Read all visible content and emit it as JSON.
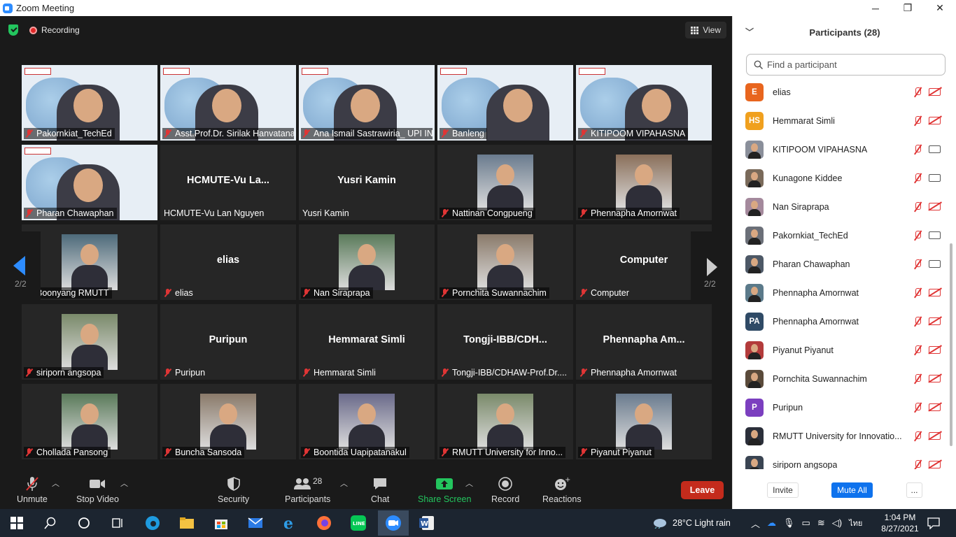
{
  "window": {
    "title": "Zoom Meeting"
  },
  "topbar": {
    "recording": "Recording",
    "view": "View"
  },
  "gallery": {
    "page_left": "2/2",
    "page_right": "2/2",
    "tiles": [
      {
        "name": "Pakornkiat_TechEd",
        "kind": "conf"
      },
      {
        "name": "Asst.Prof.Dr. Sirilak Hanvatananukul",
        "kind": "conf"
      },
      {
        "name": "Ana Ismail Sastrawiria_ UPI IN...",
        "kind": "conf"
      },
      {
        "name": "Banleng",
        "kind": "conf"
      },
      {
        "name": "KITIPOOM VIPAHASNA",
        "kind": "conf"
      },
      {
        "name": "Pharan Chawaphan",
        "kind": "conf"
      },
      {
        "name": "HCMUTE-Vu Lan Nguyen",
        "big": "HCMUTE-Vu  La...",
        "kind": "blank"
      },
      {
        "name": "Yusri Kamin",
        "big": "Yusri Kamin",
        "kind": "blank"
      },
      {
        "name": "Nattinan Congpueng",
        "kind": "photo"
      },
      {
        "name": "Phennapha Amornwat",
        "kind": "photo"
      },
      {
        "name": "Boonyang RMUTT",
        "kind": "photo"
      },
      {
        "name": "elias",
        "big": "elias",
        "kind": "blank"
      },
      {
        "name": "Nan Siraprapa",
        "kind": "photo"
      },
      {
        "name": "Pornchita Suwannachim",
        "kind": "photo"
      },
      {
        "name": "Computer",
        "big": "Computer",
        "kind": "blank"
      },
      {
        "name": "siriporn angsopa",
        "kind": "photo"
      },
      {
        "name": "Puripun",
        "big": "Puripun",
        "kind": "blank"
      },
      {
        "name": "Hemmarat Simli",
        "big": "Hemmarat Simli",
        "kind": "blank"
      },
      {
        "name": "Tongji-IBB/CDHAW-Prof.Dr....",
        "big": "Tongji-IBB/CDH...",
        "kind": "blank"
      },
      {
        "name": "Phennapha Amornwat",
        "big": "Phennapha  Am...",
        "kind": "blank"
      },
      {
        "name": "Chollada Pansong",
        "kind": "photo"
      },
      {
        "name": "Buncha Sansoda",
        "kind": "photo"
      },
      {
        "name": "Boontida Uapipatanakul",
        "kind": "photo"
      },
      {
        "name": "RMUTT University for Inno...",
        "kind": "photo"
      },
      {
        "name": "Piyanut Piyanut",
        "kind": "photo"
      }
    ]
  },
  "toolbar": {
    "unmute": "Unmute",
    "stop_video": "Stop Video",
    "security": "Security",
    "participants": "Participants",
    "participants_count": "28",
    "chat": "Chat",
    "share_screen": "Share Screen",
    "record": "Record",
    "reactions": "Reactions",
    "leave": "Leave"
  },
  "panel": {
    "title": "Participants (28)",
    "search_placeholder": "Find a participant",
    "invite": "Invite",
    "mute_all": "Mute All",
    "more": "...",
    "participants": [
      {
        "name": "elias",
        "initials": "E",
        "color": "#e8651e",
        "cam": "off"
      },
      {
        "name": "Hemmarat Simli",
        "initials": "HS",
        "color": "#f0a01e",
        "cam": "off"
      },
      {
        "name": "KITIPOOM VIPAHASNA",
        "initials": "",
        "color": "#8a8f9a",
        "cam": "on"
      },
      {
        "name": "Kunagone Kiddee",
        "initials": "",
        "color": "#7a6a5a",
        "cam": "on"
      },
      {
        "name": "Nan Siraprapa",
        "initials": "",
        "color": "#a4899c",
        "cam": "off"
      },
      {
        "name": "Pakornkiat_TechEd",
        "initials": "",
        "color": "#6b6f78",
        "cam": "on"
      },
      {
        "name": "Pharan Chawaphan",
        "initials": "",
        "color": "#4d5866",
        "cam": "on"
      },
      {
        "name": "Phennapha Amornwat",
        "initials": "",
        "color": "#5b7a8a",
        "cam": "off"
      },
      {
        "name": "Phennapha Amornwat",
        "initials": "PA",
        "color": "#2f4a66",
        "cam": "off"
      },
      {
        "name": "Piyanut Piyanut",
        "initials": "",
        "color": "#b33b3b",
        "cam": "off"
      },
      {
        "name": "Pornchita Suwannachim",
        "initials": "",
        "color": "#5a4a3a",
        "cam": "off"
      },
      {
        "name": "Puripun",
        "initials": "P",
        "color": "#7b3fbf",
        "cam": "off"
      },
      {
        "name": "RMUTT University for Innovatio...",
        "initials": "",
        "color": "#2b2f3a",
        "cam": "off"
      },
      {
        "name": "siriporn angsopa",
        "initials": "",
        "color": "#3a4452",
        "cam": "off"
      }
    ]
  },
  "taskbar": {
    "weather": "28°C  Light rain",
    "time": "1:04 PM",
    "date": "8/27/2021",
    "lang": "ไทย"
  }
}
